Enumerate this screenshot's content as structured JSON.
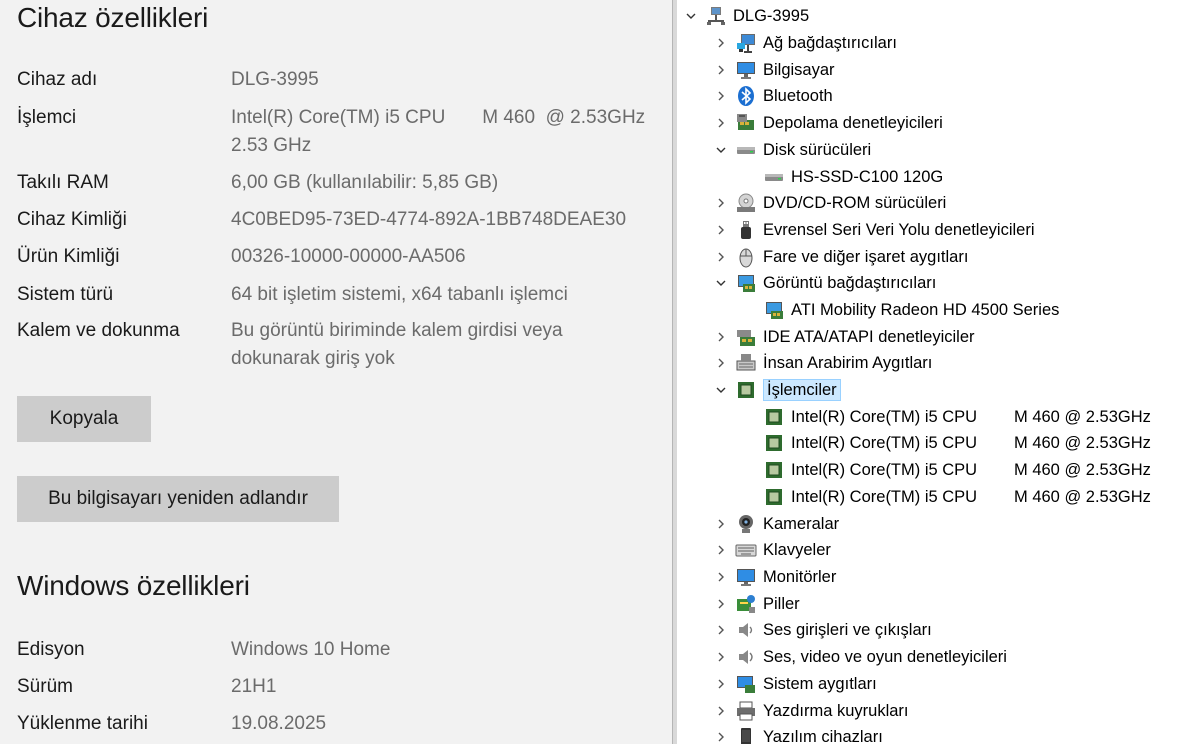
{
  "device_specs": {
    "title": "Cihaz özellikleri",
    "rows": [
      {
        "label": "Cihaz adı",
        "value": "DLG-3995"
      },
      {
        "label": "İşlemci",
        "value": "Intel(R) Core(TM) i5 CPU       M 460  @ 2.53GHz\n2.53 GHz"
      },
      {
        "label": "Takılı RAM",
        "value": "6,00 GB (kullanılabilir: 5,85 GB)"
      },
      {
        "label": "Cihaz Kimliği",
        "value": "4C0BED95-73ED-4774-892A-1BB748DEAE30"
      },
      {
        "label": "Ürün Kimliği",
        "value": "00326-10000-00000-AA506"
      },
      {
        "label": "Sistem türü",
        "value": "64 bit işletim sistemi, x64 tabanlı işlemci"
      },
      {
        "label": "Kalem ve dokunma",
        "value": "Bu görüntü biriminde kalem girdisi veya\ndokunarak giriş yok"
      }
    ],
    "copy_button": "Kopyala",
    "rename_button": "Bu bilgisayarı yeniden adlandır"
  },
  "windows_specs": {
    "title": "Windows özellikleri",
    "rows": [
      {
        "label": "Edisyon",
        "value": "Windows 10 Home"
      },
      {
        "label": "Sürüm",
        "value": "21H1"
      },
      {
        "label": "Yüklenme tarihi",
        "value": "19.08.2025"
      }
    ]
  },
  "device_manager": {
    "root": "DLG-3995",
    "nodes": [
      {
        "label": "Ağ bağdaştırıcıları",
        "icon": "network-adapter-icon",
        "expanded": false
      },
      {
        "label": "Bilgisayar",
        "icon": "computer-icon",
        "expanded": false
      },
      {
        "label": "Bluetooth",
        "icon": "bluetooth-icon",
        "expanded": false
      },
      {
        "label": "Depolama denetleyicileri",
        "icon": "storage-controller-icon",
        "expanded": false
      },
      {
        "label": "Disk sürücüleri",
        "icon": "disk-drive-icon",
        "expanded": true,
        "children": [
          "HS-SSD-C100 120G"
        ]
      },
      {
        "label": "DVD/CD-ROM sürücüleri",
        "icon": "dvd-icon",
        "expanded": false
      },
      {
        "label": "Evrensel Seri Veri Yolu denetleyicileri",
        "icon": "usb-icon",
        "expanded": false
      },
      {
        "label": "Fare ve diğer işaret aygıtları",
        "icon": "mouse-icon",
        "expanded": false
      },
      {
        "label": "Görüntü bağdaştırıcıları",
        "icon": "display-adapter-icon",
        "expanded": true,
        "children": [
          "ATI Mobility Radeon HD 4500 Series"
        ]
      },
      {
        "label": "IDE ATA/ATAPI denetleyiciler",
        "icon": "ide-controller-icon",
        "expanded": false
      },
      {
        "label": "İnsan Arabirim Aygıtları",
        "icon": "hid-icon",
        "expanded": false
      },
      {
        "label": "İşlemciler",
        "icon": "processor-icon",
        "expanded": true,
        "selected": true,
        "cpu_children": [
          {
            "name": "Intel(R) Core(TM) i5 CPU",
            "model": "M 460  @ 2.53GHz"
          },
          {
            "name": "Intel(R) Core(TM) i5 CPU",
            "model": "M 460  @ 2.53GHz"
          },
          {
            "name": "Intel(R) Core(TM) i5 CPU",
            "model": "M 460  @ 2.53GHz"
          },
          {
            "name": "Intel(R) Core(TM) i5 CPU",
            "model": "M 460  @ 2.53GHz"
          }
        ]
      },
      {
        "label": "Kameralar",
        "icon": "camera-icon",
        "expanded": false
      },
      {
        "label": "Klavyeler",
        "icon": "keyboard-icon",
        "expanded": false
      },
      {
        "label": "Monitörler",
        "icon": "monitor-icon",
        "expanded": false
      },
      {
        "label": "Piller",
        "icon": "battery-icon",
        "expanded": false
      },
      {
        "label": "Ses girişleri ve çıkışları",
        "icon": "speaker-icon",
        "expanded": false
      },
      {
        "label": "Ses, video ve oyun denetleyicileri",
        "icon": "sound-controller-icon",
        "expanded": false
      },
      {
        "label": "Sistem aygıtları",
        "icon": "system-devices-icon",
        "expanded": false
      },
      {
        "label": "Yazdırma kuyrukları",
        "icon": "printer-icon",
        "expanded": false
      },
      {
        "label": "Yazılım cihazları",
        "icon": "software-device-icon",
        "expanded": false
      }
    ]
  },
  "colors": {
    "settings_bg": "#f2f2f2",
    "button_bg": "#cccccc",
    "value_text": "#6b6b6b",
    "selection_bg": "#cce8ff"
  }
}
